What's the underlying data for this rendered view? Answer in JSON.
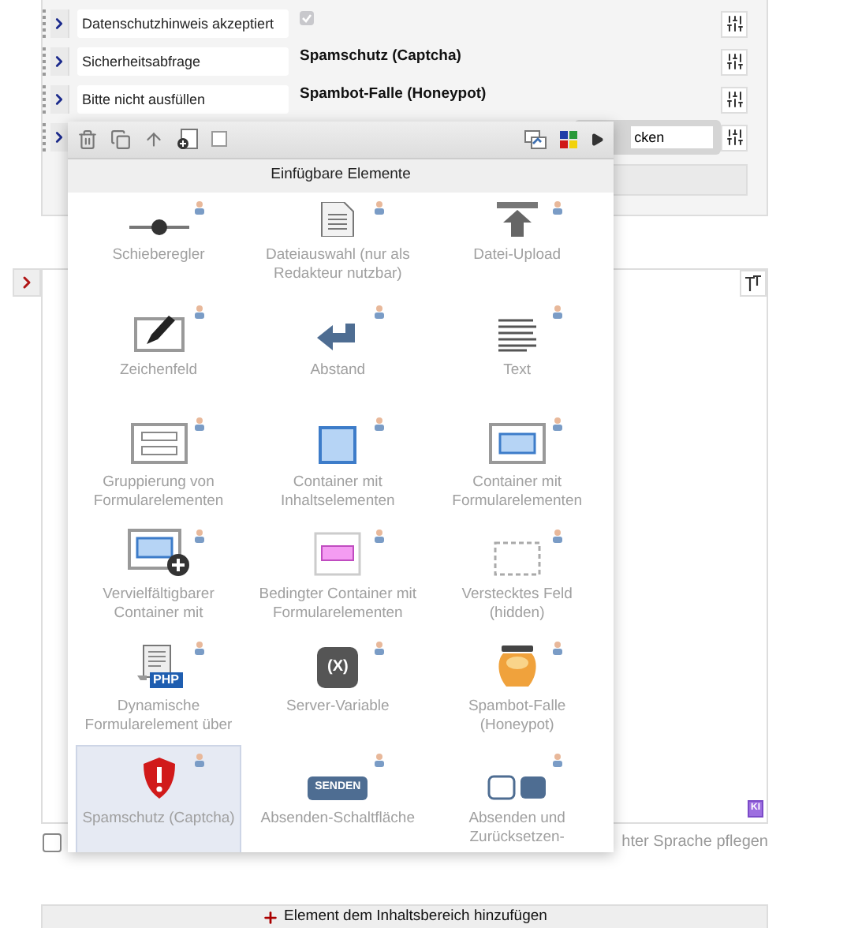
{
  "form_rows": [
    {
      "kind": "checkbox",
      "label": "Datenschutzhinweis akzeptiert",
      "checked": true
    },
    {
      "kind": "text",
      "label": "Sicherheitsabfrage",
      "value": "Spamschutz (Captcha)"
    },
    {
      "kind": "text",
      "label": "Bitte nicht ausfüllen",
      "value": "Spambot-Falle (Honeypot)"
    },
    {
      "kind": "input",
      "value": "cken"
    }
  ],
  "editor": {
    "badge": "KI"
  },
  "language_option": {
    "checked": false,
    "label": "hter Sprache pflegen"
  },
  "add_button": {
    "label": "Element dem Inhaltsbereich hinzufügen"
  },
  "popup": {
    "toolbar_checkbox": {
      "checked": false
    },
    "title": "Einfügbare Elemente",
    "items": [
      {
        "kind": "slider",
        "label": "Schieberegler",
        "selected": false
      },
      {
        "kind": "file",
        "label": "Dateiauswahl (nur als Redakteur nutzbar)",
        "selected": false
      },
      {
        "kind": "upload",
        "label": "Datei-Upload",
        "selected": false
      },
      {
        "kind": "draw",
        "label": "Zeichenfeld",
        "selected": false
      },
      {
        "kind": "spacing",
        "label": "Abstand",
        "selected": false
      },
      {
        "kind": "text",
        "label": "Text",
        "selected": false
      },
      {
        "kind": "group",
        "label": "Gruppierung von Formularelementen",
        "selected": false
      },
      {
        "kind": "container",
        "label": "Container mit Inhaltselementen",
        "selected": false
      },
      {
        "kind": "form-container",
        "label": "Container mit Formularelementen",
        "selected": false
      },
      {
        "kind": "repeat",
        "label": "Vervielfältigbarer Container mit",
        "selected": false
      },
      {
        "kind": "conditional",
        "label": "Bedingter Container mit Formularelementen",
        "selected": false
      },
      {
        "kind": "hidden",
        "label": "Verstecktes Feld (hidden)",
        "selected": false
      },
      {
        "kind": "php",
        "icon_text": "PHP",
        "label": "Dynamische Formularelement über",
        "selected": false
      },
      {
        "kind": "variable",
        "icon_text": "(X)",
        "label": "Server-Variable",
        "selected": false
      },
      {
        "kind": "honeypot",
        "label": "Spambot-Falle (Honeypot)",
        "selected": false
      },
      {
        "kind": "captcha",
        "label": "Spamschutz (Captcha)",
        "selected": true
      },
      {
        "kind": "submit",
        "icon_text": "SENDEN",
        "label": "Absenden-Schaltfläche",
        "selected": false
      },
      {
        "kind": "submit-reset",
        "label": "Absenden und Zurücksetzen-",
        "selected": false
      }
    ]
  }
}
